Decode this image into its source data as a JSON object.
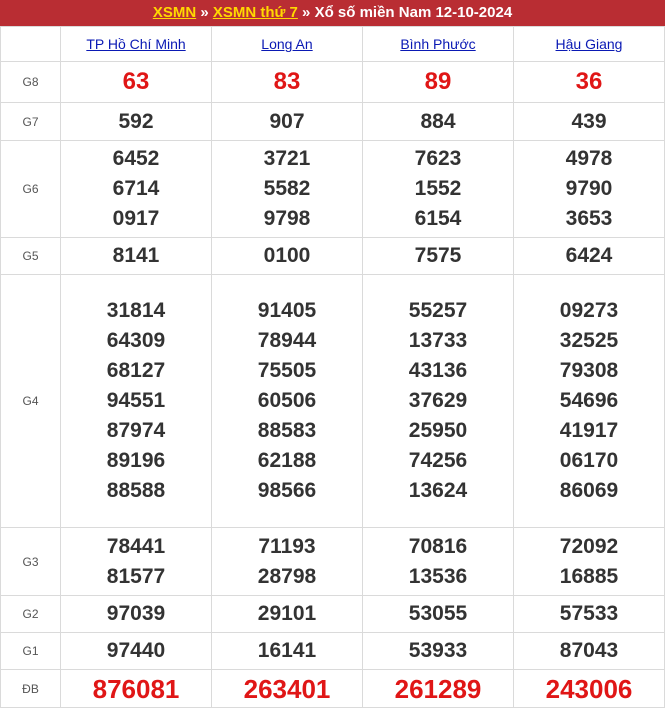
{
  "breadcrumb": {
    "link1": "XSMN",
    "sep1": " » ",
    "link2": "XSMN thứ 7",
    "sep2": " » ",
    "title": "Xổ số miền Nam 12-10-2024"
  },
  "provinces": [
    "TP Hồ Chí Minh",
    "Long An",
    "Bình Phước",
    "Hậu Giang"
  ],
  "prizes": [
    {
      "label": "G8",
      "values": [
        [
          "63"
        ],
        [
          "83"
        ],
        [
          "89"
        ],
        [
          "36"
        ]
      ]
    },
    {
      "label": "G7",
      "values": [
        [
          "592"
        ],
        [
          "907"
        ],
        [
          "884"
        ],
        [
          "439"
        ]
      ]
    },
    {
      "label": "G6",
      "values": [
        [
          "6452",
          "6714",
          "0917"
        ],
        [
          "3721",
          "5582",
          "9798"
        ],
        [
          "7623",
          "1552",
          "6154"
        ],
        [
          "4978",
          "9790",
          "3653"
        ]
      ]
    },
    {
      "label": "G5",
      "values": [
        [
          "8141"
        ],
        [
          "0100"
        ],
        [
          "7575"
        ],
        [
          "6424"
        ]
      ]
    },
    {
      "label": "G4",
      "values": [
        [
          "31814",
          "64309",
          "68127",
          "94551",
          "87974",
          "89196",
          "88588"
        ],
        [
          "91405",
          "78944",
          "75505",
          "60506",
          "88583",
          "62188",
          "98566"
        ],
        [
          "55257",
          "13733",
          "43136",
          "37629",
          "25950",
          "74256",
          "13624"
        ],
        [
          "09273",
          "32525",
          "79308",
          "54696",
          "41917",
          "06170",
          "86069"
        ]
      ]
    },
    {
      "label": "G3",
      "values": [
        [
          "78441",
          "81577"
        ],
        [
          "71193",
          "28798"
        ],
        [
          "70816",
          "13536"
        ],
        [
          "72092",
          "16885"
        ]
      ]
    },
    {
      "label": "G2",
      "values": [
        [
          "97039"
        ],
        [
          "29101"
        ],
        [
          "53055"
        ],
        [
          "57533"
        ]
      ]
    },
    {
      "label": "G1",
      "values": [
        [
          "97440"
        ],
        [
          "16141"
        ],
        [
          "53933"
        ],
        [
          "87043"
        ]
      ]
    },
    {
      "label": "ĐB",
      "values": [
        [
          "876081"
        ],
        [
          "263401"
        ],
        [
          "261289"
        ],
        [
          "243006"
        ]
      ]
    }
  ],
  "colors": {
    "header_bg": "#b92d33",
    "link_yellow": "#ffd800",
    "province_link": "#0a19b4",
    "highlight_red": "#e01616"
  }
}
